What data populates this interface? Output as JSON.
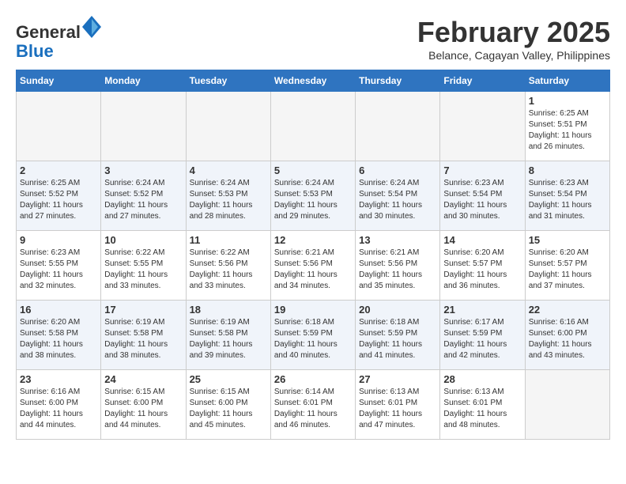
{
  "header": {
    "logo_general": "General",
    "logo_blue": "Blue",
    "month_title": "February 2025",
    "subtitle": "Belance, Cagayan Valley, Philippines"
  },
  "weekdays": [
    "Sunday",
    "Monday",
    "Tuesday",
    "Wednesday",
    "Thursday",
    "Friday",
    "Saturday"
  ],
  "weeks": [
    [
      {
        "day": "",
        "info": ""
      },
      {
        "day": "",
        "info": ""
      },
      {
        "day": "",
        "info": ""
      },
      {
        "day": "",
        "info": ""
      },
      {
        "day": "",
        "info": ""
      },
      {
        "day": "",
        "info": ""
      },
      {
        "day": "1",
        "info": "Sunrise: 6:25 AM\nSunset: 5:51 PM\nDaylight: 11 hours and 26 minutes."
      }
    ],
    [
      {
        "day": "2",
        "info": "Sunrise: 6:25 AM\nSunset: 5:52 PM\nDaylight: 11 hours and 27 minutes."
      },
      {
        "day": "3",
        "info": "Sunrise: 6:24 AM\nSunset: 5:52 PM\nDaylight: 11 hours and 27 minutes."
      },
      {
        "day": "4",
        "info": "Sunrise: 6:24 AM\nSunset: 5:53 PM\nDaylight: 11 hours and 28 minutes."
      },
      {
        "day": "5",
        "info": "Sunrise: 6:24 AM\nSunset: 5:53 PM\nDaylight: 11 hours and 29 minutes."
      },
      {
        "day": "6",
        "info": "Sunrise: 6:24 AM\nSunset: 5:54 PM\nDaylight: 11 hours and 30 minutes."
      },
      {
        "day": "7",
        "info": "Sunrise: 6:23 AM\nSunset: 5:54 PM\nDaylight: 11 hours and 30 minutes."
      },
      {
        "day": "8",
        "info": "Sunrise: 6:23 AM\nSunset: 5:54 PM\nDaylight: 11 hours and 31 minutes."
      }
    ],
    [
      {
        "day": "9",
        "info": "Sunrise: 6:23 AM\nSunset: 5:55 PM\nDaylight: 11 hours and 32 minutes."
      },
      {
        "day": "10",
        "info": "Sunrise: 6:22 AM\nSunset: 5:55 PM\nDaylight: 11 hours and 33 minutes."
      },
      {
        "day": "11",
        "info": "Sunrise: 6:22 AM\nSunset: 5:56 PM\nDaylight: 11 hours and 33 minutes."
      },
      {
        "day": "12",
        "info": "Sunrise: 6:21 AM\nSunset: 5:56 PM\nDaylight: 11 hours and 34 minutes."
      },
      {
        "day": "13",
        "info": "Sunrise: 6:21 AM\nSunset: 5:56 PM\nDaylight: 11 hours and 35 minutes."
      },
      {
        "day": "14",
        "info": "Sunrise: 6:20 AM\nSunset: 5:57 PM\nDaylight: 11 hours and 36 minutes."
      },
      {
        "day": "15",
        "info": "Sunrise: 6:20 AM\nSunset: 5:57 PM\nDaylight: 11 hours and 37 minutes."
      }
    ],
    [
      {
        "day": "16",
        "info": "Sunrise: 6:20 AM\nSunset: 5:58 PM\nDaylight: 11 hours and 38 minutes."
      },
      {
        "day": "17",
        "info": "Sunrise: 6:19 AM\nSunset: 5:58 PM\nDaylight: 11 hours and 38 minutes."
      },
      {
        "day": "18",
        "info": "Sunrise: 6:19 AM\nSunset: 5:58 PM\nDaylight: 11 hours and 39 minutes."
      },
      {
        "day": "19",
        "info": "Sunrise: 6:18 AM\nSunset: 5:59 PM\nDaylight: 11 hours and 40 minutes."
      },
      {
        "day": "20",
        "info": "Sunrise: 6:18 AM\nSunset: 5:59 PM\nDaylight: 11 hours and 41 minutes."
      },
      {
        "day": "21",
        "info": "Sunrise: 6:17 AM\nSunset: 5:59 PM\nDaylight: 11 hours and 42 minutes."
      },
      {
        "day": "22",
        "info": "Sunrise: 6:16 AM\nSunset: 6:00 PM\nDaylight: 11 hours and 43 minutes."
      }
    ],
    [
      {
        "day": "23",
        "info": "Sunrise: 6:16 AM\nSunset: 6:00 PM\nDaylight: 11 hours and 44 minutes."
      },
      {
        "day": "24",
        "info": "Sunrise: 6:15 AM\nSunset: 6:00 PM\nDaylight: 11 hours and 44 minutes."
      },
      {
        "day": "25",
        "info": "Sunrise: 6:15 AM\nSunset: 6:00 PM\nDaylight: 11 hours and 45 minutes."
      },
      {
        "day": "26",
        "info": "Sunrise: 6:14 AM\nSunset: 6:01 PM\nDaylight: 11 hours and 46 minutes."
      },
      {
        "day": "27",
        "info": "Sunrise: 6:13 AM\nSunset: 6:01 PM\nDaylight: 11 hours and 47 minutes."
      },
      {
        "day": "28",
        "info": "Sunrise: 6:13 AM\nSunset: 6:01 PM\nDaylight: 11 hours and 48 minutes."
      },
      {
        "day": "",
        "info": ""
      }
    ]
  ]
}
